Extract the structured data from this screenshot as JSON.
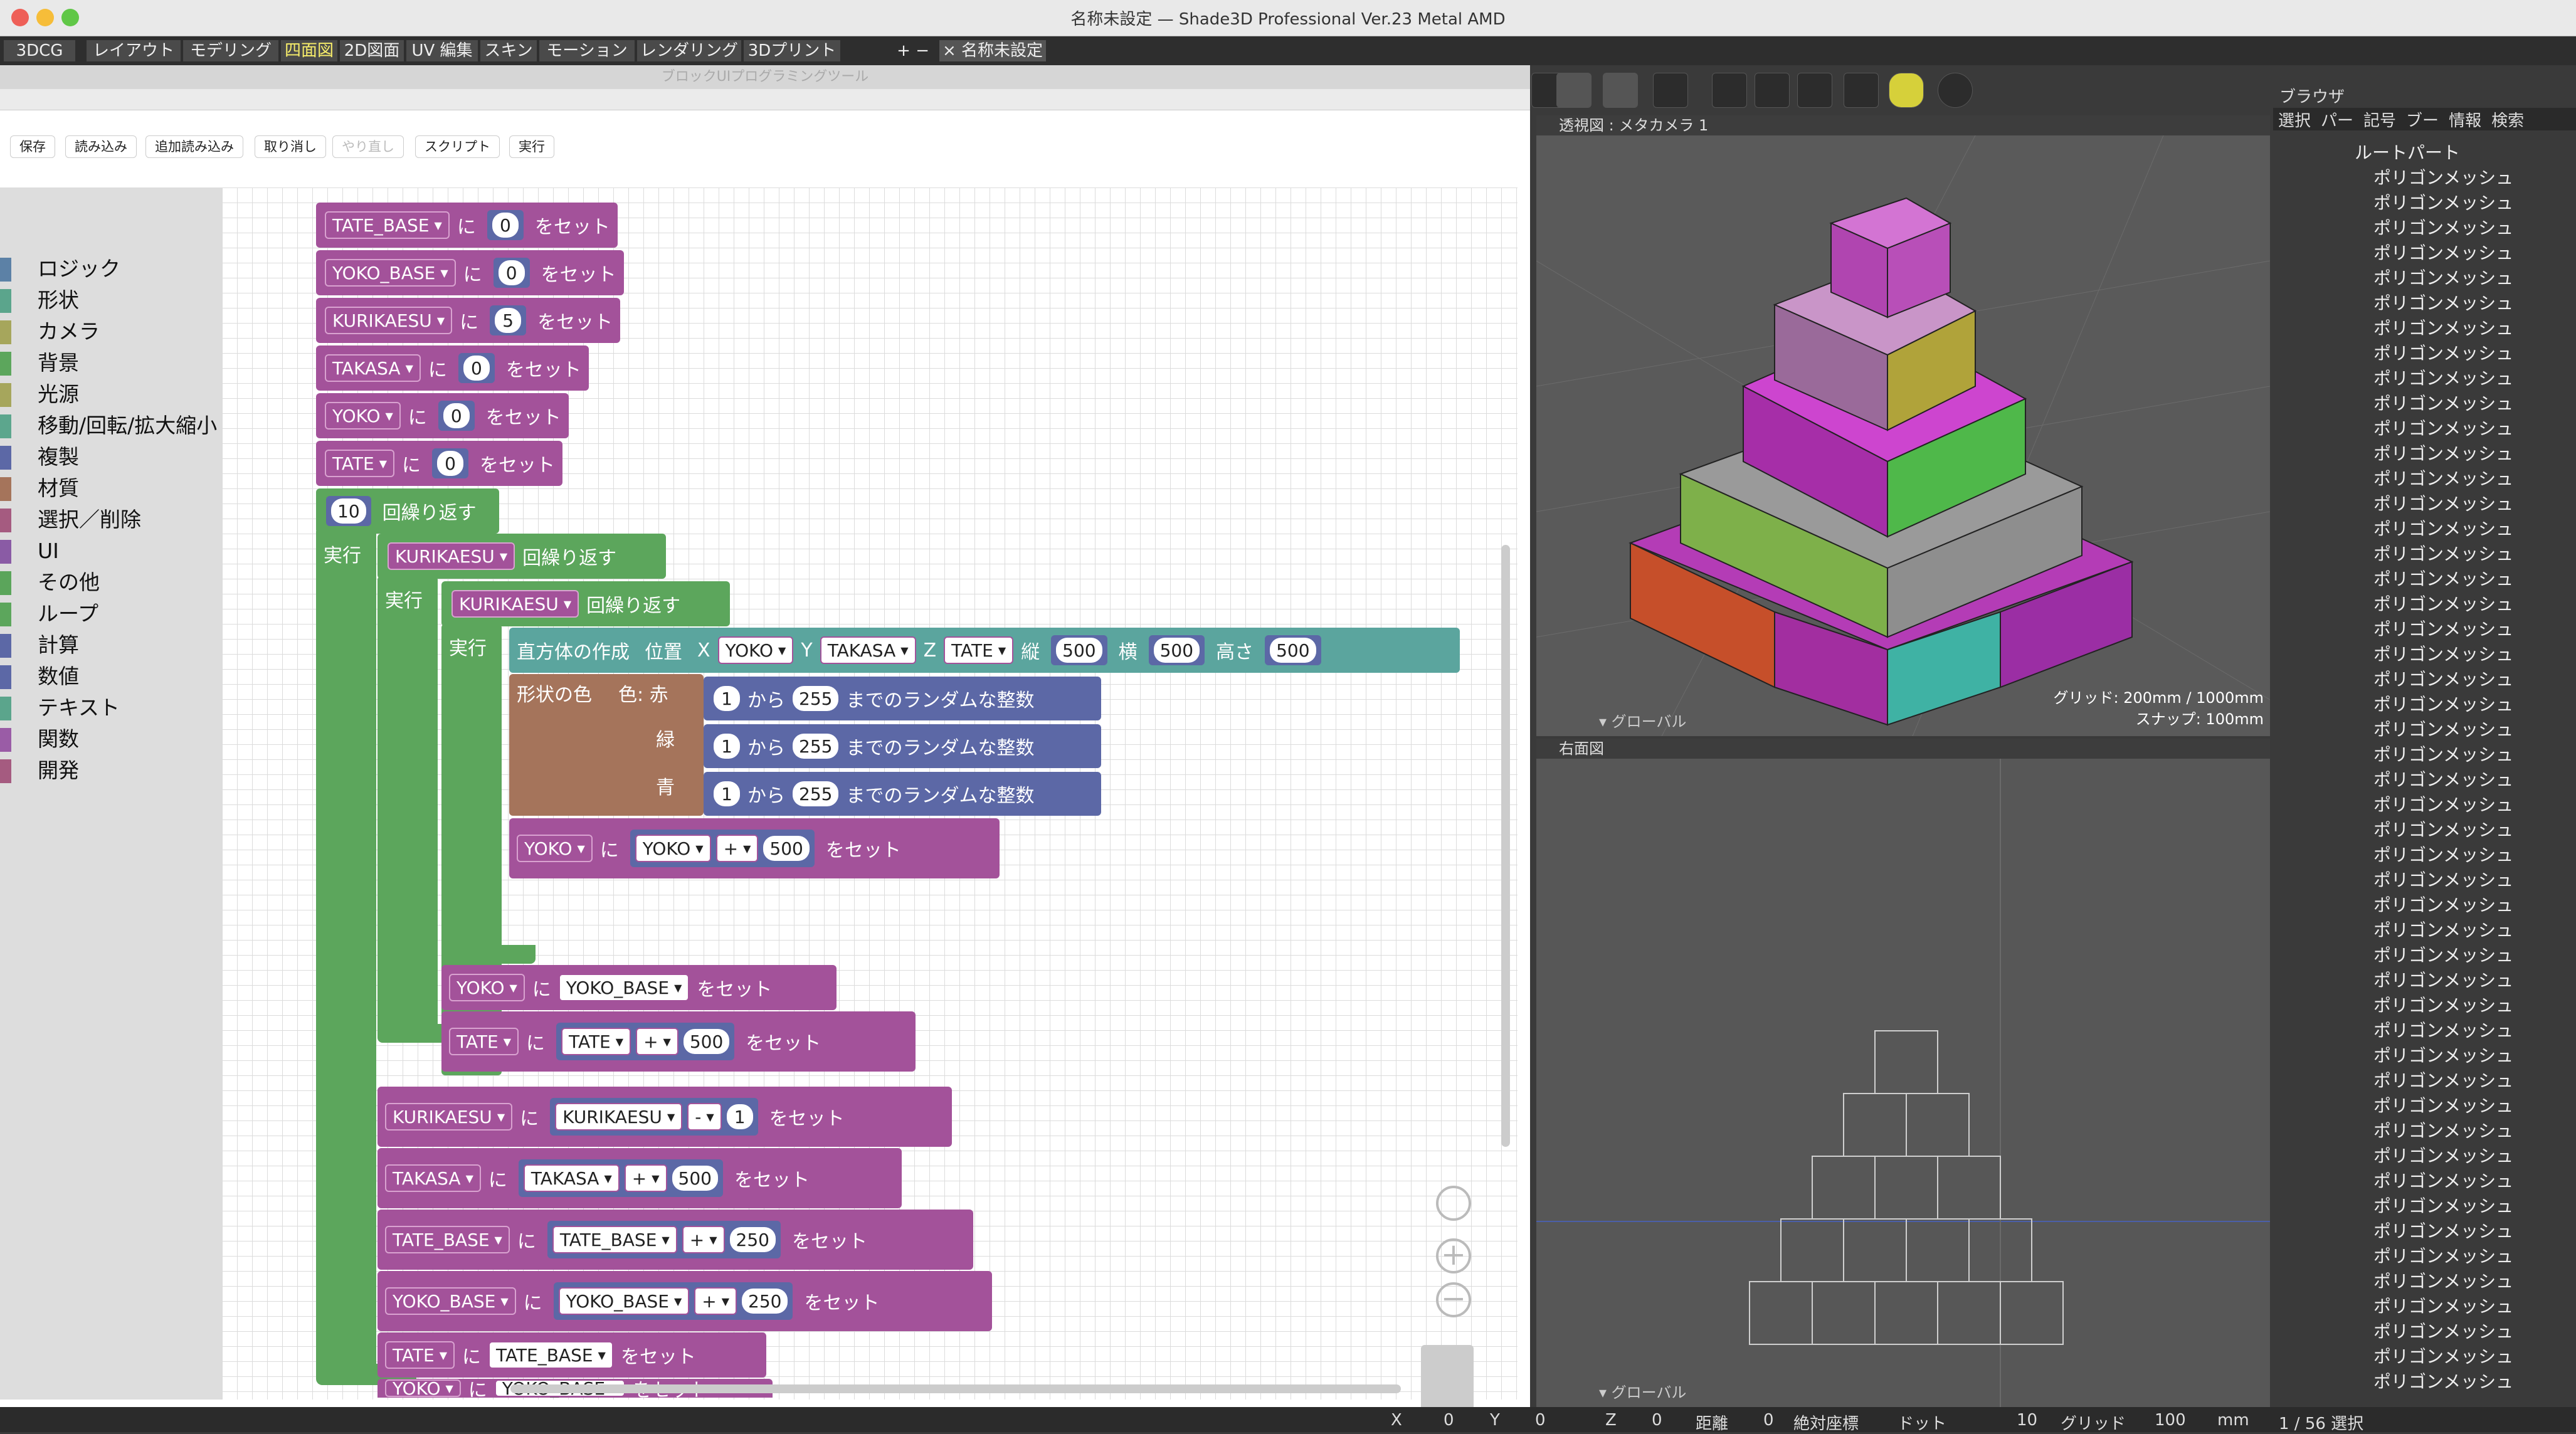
{
  "app": {
    "window_title": "名称未設定 — Shade3D Professional Ver.23 Metal AMD"
  },
  "tabs": [
    {
      "label": "3DCG"
    },
    {
      "label": "レイアウト"
    },
    {
      "label": "モデリング"
    },
    {
      "label": "四面図"
    },
    {
      "label": "2D図面"
    },
    {
      "label": "UV 編集"
    },
    {
      "label": "スキン"
    },
    {
      "label": "モーション"
    },
    {
      "label": "レンダリング"
    },
    {
      "label": "3Dプリント"
    },
    {
      "label": "+ −"
    },
    {
      "label": "× 名称未設定"
    }
  ],
  "tool_window": {
    "title": "ブロックUIプログラミングツール",
    "toolbar": [
      "保存",
      "読み込み",
      "追加読み込み",
      "取り消し",
      "やり直し",
      "スクリプト",
      "実行"
    ]
  },
  "categories": [
    {
      "label": "ロジック",
      "color": "#5c81a6"
    },
    {
      "label": "形状",
      "color": "#5ba58c"
    },
    {
      "label": "カメラ",
      "color": "#a6a65c"
    },
    {
      "label": "背景",
      "color": "#5ca65c"
    },
    {
      "label": "光源",
      "color": "#a6a65c"
    },
    {
      "label": "移動/回転/拡大縮小",
      "color": "#5ca68d"
    },
    {
      "label": "複製",
      "color": "#5c68a6"
    },
    {
      "label": "材質",
      "color": "#a5745b"
    },
    {
      "label": "選択／削除",
      "color": "#a55b80"
    },
    {
      "label": "UI",
      "color": "#8a5ba5"
    },
    {
      "label": "その他",
      "color": "#5ba55b"
    },
    {
      "label": "ループ",
      "color": "#5ca65c"
    },
    {
      "label": "計算",
      "color": "#5c68a6"
    },
    {
      "label": "数値",
      "color": "#5c68a6"
    },
    {
      "label": "テキスト",
      "color": "#5ba58c"
    },
    {
      "label": "関数",
      "color": "#9a5ca6"
    },
    {
      "label": "開発",
      "color": "#a55b80"
    }
  ],
  "blocks": {
    "set_word": "をセット",
    "ni": "に",
    "repeat_word": "回繰り返す",
    "exec_word": "実行",
    "sets": [
      {
        "var": "TATE_BASE",
        "value": "0"
      },
      {
        "var": "YOKO_BASE",
        "value": "0"
      },
      {
        "var": "KURIKAESU",
        "value": "5"
      },
      {
        "var": "TAKASA",
        "value": "0"
      },
      {
        "var": "YOKO",
        "value": "0"
      },
      {
        "var": "TATE",
        "value": "0"
      }
    ],
    "outer_repeat": "10",
    "loop_var": "KURIKAESU",
    "create": {
      "label": "直方体の作成",
      "pos": "位置",
      "x": "X",
      "y": "Y",
      "z": "Z",
      "xv": "YOKO",
      "yv": "TAKASA",
      "zv": "TATE",
      "depth_label": "縦",
      "depth": "500",
      "width_label": "横",
      "width": "500",
      "height_label": "高さ",
      "height": "500"
    },
    "color": {
      "label": "形状の色",
      "r_label": "色: 赤",
      "g_label": "緑",
      "b_label": "青",
      "from": "1",
      "kara": "から",
      "to": "255",
      "rand": "までのランダムな整数"
    },
    "ops": [
      {
        "var": "YOKO",
        "src": "YOKO",
        "op": "+",
        "num": "500"
      },
      {
        "var": "YOKO",
        "src": "YOKO_BASE"
      },
      {
        "var": "TATE",
        "src": "TATE",
        "op": "+",
        "num": "500"
      },
      {
        "var": "KURIKAESU",
        "src": "KURIKAESU",
        "op": "-",
        "num": "1"
      },
      {
        "var": "TAKASA",
        "src": "TAKASA",
        "op": "+",
        "num": "500"
      },
      {
        "var": "TATE_BASE",
        "src": "TATE_BASE",
        "op": "+",
        "num": "250"
      },
      {
        "var": "YOKO_BASE",
        "src": "YOKO_BASE",
        "op": "+",
        "num": "250"
      },
      {
        "var": "TATE",
        "src": "TATE_BASE"
      },
      {
        "var": "YOKO",
        "src": "YOKO_BASE"
      }
    ]
  },
  "viewport_perspective": {
    "label": "透視図 : メタカメラ 1",
    "grid": "グリッド: 200mm / 1000mm",
    "snap": "スナップ: 100mm",
    "axis": "▾ グローバル"
  },
  "viewport_right": {
    "label": "右面図",
    "axis": "▾ グローバル"
  },
  "browser": {
    "title": "ブラウザ",
    "tabs": [
      "選択",
      "パー",
      "記号",
      "ブー",
      "情報",
      "検索"
    ],
    "root": "ルートパート",
    "item_label": "ポリゴンメッシュ"
  },
  "status": {
    "x_label": "X",
    "x": "0",
    "y_label": "Y",
    "y": "0",
    "z_label": "Z",
    "z": "0",
    "dist_label": "距離",
    "dist": "0",
    "coord": "絶対座標",
    "dot_label": "ドット",
    "dot": "10",
    "grid_label": "グリッド",
    "grid": "100",
    "unit": "mm",
    "selection": "1 / 56 選択"
  }
}
